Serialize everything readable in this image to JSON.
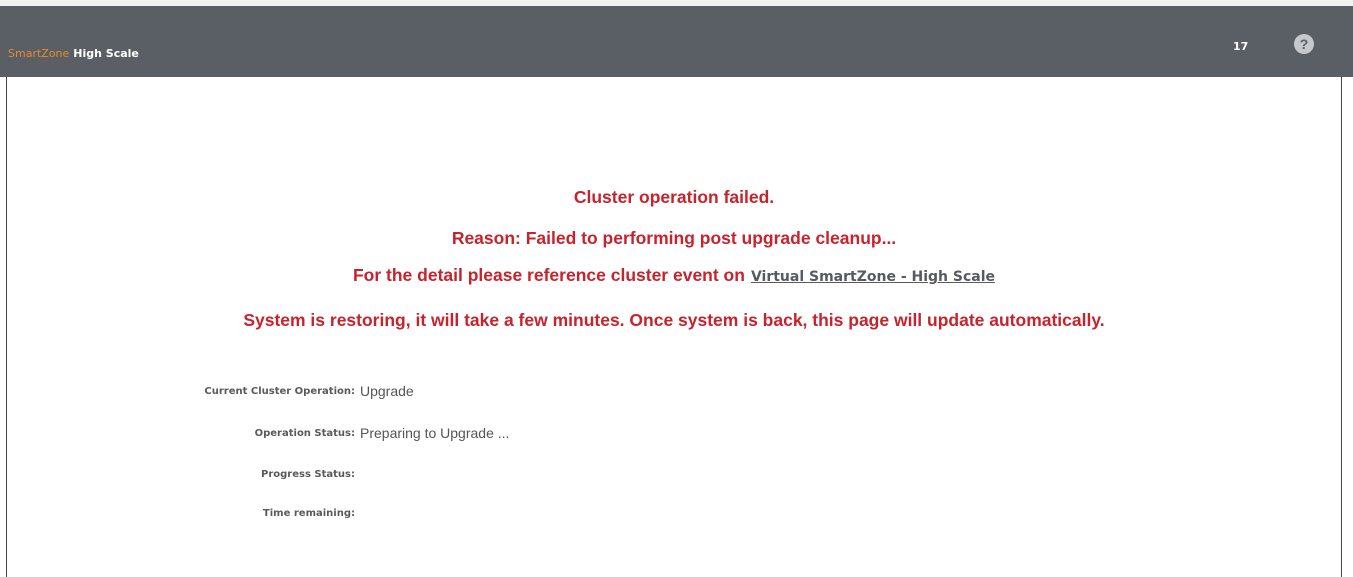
{
  "header": {
    "brand_primary": "SmartZone",
    "brand_secondary": "High Scale",
    "count": "17",
    "help_icon": "question-circle-icon",
    "colors": {
      "bar": "#5a5f66",
      "brand_accent": "#e8892c"
    }
  },
  "messages": {
    "line1": "Cluster operation failed.",
    "line2": "Reason: Failed to performing post upgrade cleanup...",
    "line3": "For the detail please reference cluster event on",
    "line3_link": "Virtual SmartZone - High Scale",
    "line4": "System is restoring, it will take a few minutes. Once system is back, this page will update automatically.",
    "color": "#c8232c"
  },
  "status": {
    "rows": [
      {
        "label": "Current Cluster Operation:",
        "value": "Upgrade"
      },
      {
        "label": "Operation Status:",
        "value": "Preparing to Upgrade ..."
      },
      {
        "label": "Progress Status:",
        "value": ""
      },
      {
        "label": "Time remaining:",
        "value": ""
      }
    ]
  }
}
